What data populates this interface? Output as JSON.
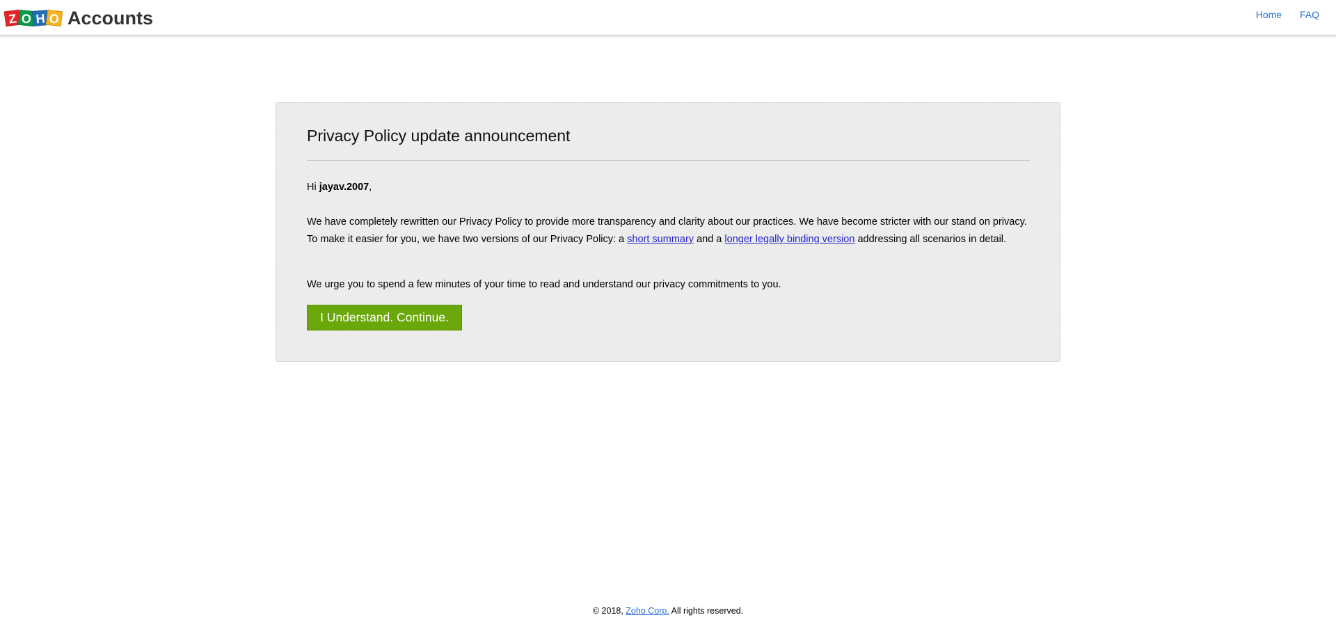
{
  "header": {
    "logo_letters": [
      "Z",
      "O",
      "H",
      "O"
    ],
    "logo_product": "Accounts",
    "nav": [
      {
        "label": "Home"
      },
      {
        "label": "FAQ"
      }
    ]
  },
  "announcement": {
    "title": "Privacy Policy update announcement",
    "greeting_prefix": "Hi ",
    "username": "jayav.2007",
    "greeting_suffix": ",",
    "para1_part1": "We have completely rewritten our Privacy Policy to provide more transparency and clarity about our practices. We have become stricter with our stand on privacy. To make it easier for you, we have two versions of our Privacy Policy: a ",
    "link_short_summary": "short summary",
    "para1_part2": " and a ",
    "link_long_version": "longer legally binding version",
    "para1_part3": " addressing all scenarios in detail.",
    "para2": "We urge you to spend a few minutes of your time to read and understand our privacy commitments to you.",
    "button_label": "I Understand. Continue."
  },
  "footer": {
    "copyright": "© 2018, ",
    "company_link": "Zoho Corp.",
    "rights": " All rights reserved."
  },
  "colors": {
    "button_green": "#6aa709",
    "link_blue": "#2a6cd6",
    "panel_bg": "#ececec"
  }
}
